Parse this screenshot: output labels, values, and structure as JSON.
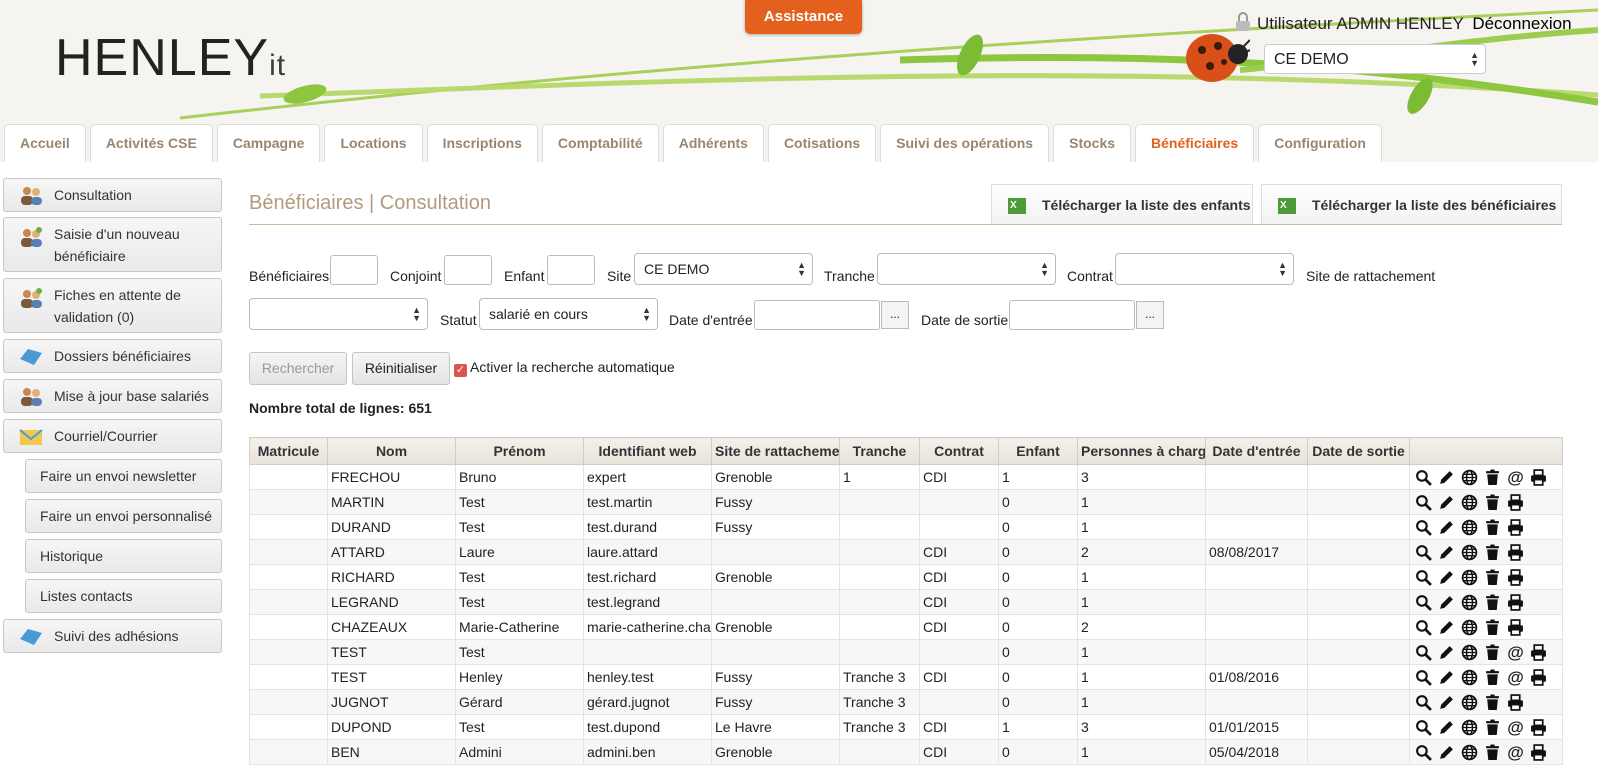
{
  "header": {
    "logo_main": "HENLEY",
    "logo_suffix": "it",
    "assistance_label": "Assistance",
    "user_text": "Utilisateur ADMIN HENLEY",
    "logout_label": "Déconnexion",
    "site_selected": "CE DEMO"
  },
  "tabs": [
    {
      "label": "Accueil"
    },
    {
      "label": "Activités CSE"
    },
    {
      "label": "Campagne"
    },
    {
      "label": "Locations"
    },
    {
      "label": "Inscriptions"
    },
    {
      "label": "Comptabilité"
    },
    {
      "label": "Adhérents"
    },
    {
      "label": "Cotisations"
    },
    {
      "label": "Suivi des opérations"
    },
    {
      "label": "Stocks"
    },
    {
      "label": "Bénéficiaires"
    },
    {
      "label": "Configuration"
    }
  ],
  "active_tab": "Bénéficiaires",
  "sidebar": {
    "items": [
      {
        "label": "Consultation"
      },
      {
        "label": "Saisie d'un nouveau bénéficiaire"
      },
      {
        "label": "Fiches en attente de validation (0)"
      },
      {
        "label": "Dossiers bénéficiaires"
      },
      {
        "label": "Mise à jour base salariés"
      },
      {
        "label": "Courriel/Courrier"
      },
      {
        "label": "Faire un envoi newsletter"
      },
      {
        "label": "Faire un envoi personnalisé"
      },
      {
        "label": "Historique"
      },
      {
        "label": "Listes contacts"
      },
      {
        "label": "Suivi des adhésions"
      }
    ]
  },
  "page": {
    "title": "Bénéficiaires | Consultation",
    "download_children": "Télécharger la liste des enfants",
    "download_beneficiaries": "Télécharger la liste des bénéficiaires"
  },
  "filters": {
    "beneficiaires_label": "Bénéficiaires",
    "conjoint_label": "Conjoint",
    "enfant_label": "Enfant",
    "site_label": "Site",
    "site_value": "CE DEMO",
    "tranche_label": "Tranche",
    "contrat_label": "Contrat",
    "site_rattachement_label": "Site de rattachement",
    "statut_label": "Statut",
    "statut_value": "salarié en cours",
    "date_entree_label": "Date d'entrée",
    "date_sortie_label": "Date de sortie",
    "dots": "...",
    "search_button": "Rechercher",
    "reset_button": "Réinitialiser",
    "auto_search_label": "Activer la recherche automatique",
    "checkmark": "✓"
  },
  "total_label": "Nombre total de lignes: 651",
  "table": {
    "headers": [
      "Matricule",
      "Nom",
      "Prénom",
      "Identifiant web",
      "Site de rattacheme",
      "Tranche",
      "Contrat",
      "Enfant",
      "Personnes à charg",
      "Date d'entrée",
      "Date de sortie",
      ""
    ],
    "rows": [
      {
        "matricule": "",
        "nom": "FRECHOU",
        "prenom": "Bruno",
        "identifiant": "expert",
        "site": "Grenoble",
        "tranche": "1",
        "contrat": "CDI",
        "enfant": "1",
        "personnes": "3",
        "entree": "",
        "sortie": "",
        "mail": true
      },
      {
        "matricule": "",
        "nom": "MARTIN",
        "prenom": "Test",
        "identifiant": "test.martin",
        "site": "Fussy",
        "tranche": "",
        "contrat": "",
        "enfant": "0",
        "personnes": "1",
        "entree": "",
        "sortie": "",
        "mail": false
      },
      {
        "matricule": "",
        "nom": "DURAND",
        "prenom": "Test",
        "identifiant": "test.durand",
        "site": "Fussy",
        "tranche": "",
        "contrat": "",
        "enfant": "0",
        "personnes": "1",
        "entree": "",
        "sortie": "",
        "mail": false
      },
      {
        "matricule": "",
        "nom": "ATTARD",
        "prenom": "Laure",
        "identifiant": "laure.attard",
        "site": "",
        "tranche": "",
        "contrat": "CDI",
        "enfant": "0",
        "personnes": "2",
        "entree": "08/08/2017",
        "sortie": "",
        "mail": false
      },
      {
        "matricule": "",
        "nom": "RICHARD",
        "prenom": "Test",
        "identifiant": "test.richard",
        "site": "Grenoble",
        "tranche": "",
        "contrat": "CDI",
        "enfant": "0",
        "personnes": "1",
        "entree": "",
        "sortie": "",
        "mail": false
      },
      {
        "matricule": "",
        "nom": "LEGRAND",
        "prenom": "Test",
        "identifiant": "test.legrand",
        "site": "",
        "tranche": "",
        "contrat": "CDI",
        "enfant": "0",
        "personnes": "1",
        "entree": "",
        "sortie": "",
        "mail": false
      },
      {
        "matricule": "",
        "nom": "CHAZEAUX",
        "prenom": "Marie-Catherine",
        "identifiant": "marie-catherine.chaz",
        "site": "Grenoble",
        "tranche": "",
        "contrat": "CDI",
        "enfant": "0",
        "personnes": "2",
        "entree": "",
        "sortie": "",
        "mail": false
      },
      {
        "matricule": "",
        "nom": "TEST",
        "prenom": "Test",
        "identifiant": "",
        "site": "",
        "tranche": "",
        "contrat": "",
        "enfant": "0",
        "personnes": "1",
        "entree": "",
        "sortie": "",
        "mail": true
      },
      {
        "matricule": "",
        "nom": "TEST",
        "prenom": "Henley",
        "identifiant": "henley.test",
        "site": "Fussy",
        "tranche": "Tranche 3",
        "contrat": "CDI",
        "enfant": "0",
        "personnes": "1",
        "entree": "01/08/2016",
        "sortie": "",
        "mail": true
      },
      {
        "matricule": "",
        "nom": "JUGNOT",
        "prenom": "Gérard",
        "identifiant": "gérard.jugnot",
        "site": "Fussy",
        "tranche": "Tranche 3",
        "contrat": "",
        "enfant": "0",
        "personnes": "1",
        "entree": "",
        "sortie": "",
        "mail": false
      },
      {
        "matricule": "",
        "nom": "DUPOND",
        "prenom": "Test",
        "identifiant": "test.dupond",
        "site": "Le Havre",
        "tranche": "Tranche 3",
        "contrat": "CDI",
        "enfant": "1",
        "personnes": "3",
        "entree": "01/01/2015",
        "sortie": "",
        "mail": true
      },
      {
        "matricule": "",
        "nom": "BEN",
        "prenom": "Admini",
        "identifiant": "admini.ben",
        "site": "Grenoble",
        "tranche": "",
        "contrat": "CDI",
        "enfant": "0",
        "personnes": "1",
        "entree": "05/04/2018",
        "sortie": "",
        "mail": true
      }
    ]
  },
  "colors": {
    "accent": "#e3611c",
    "title": "#b39a7c",
    "tab_text": "#9a8670",
    "leaf": "#8dc63f"
  }
}
